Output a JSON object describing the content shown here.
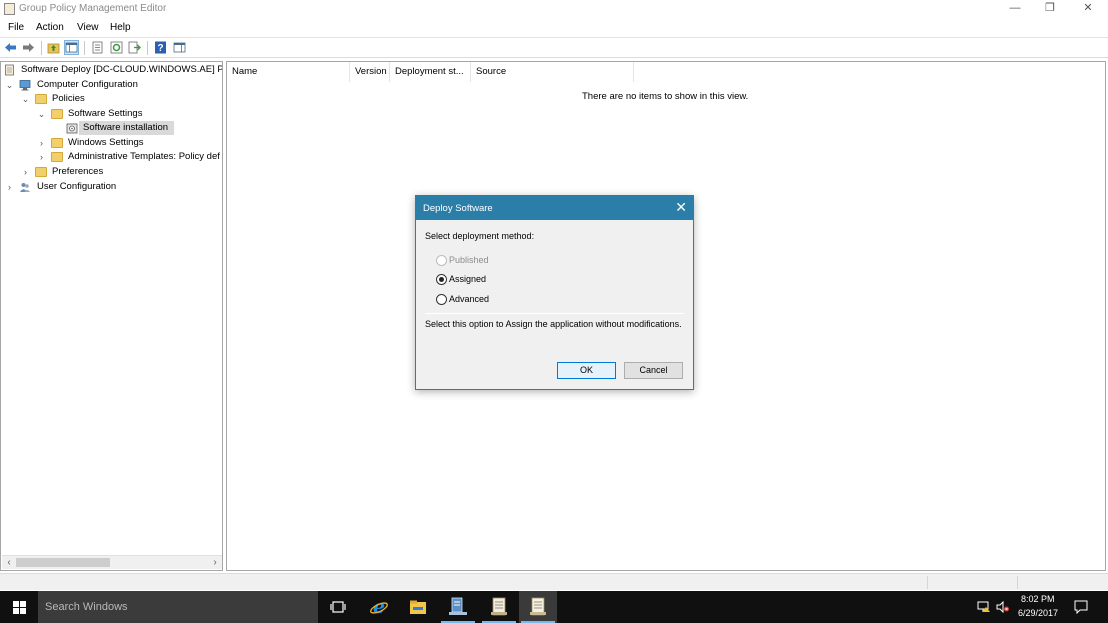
{
  "window": {
    "title": "Group Policy Management Editor",
    "minimize_glyph": "—",
    "restore_glyph": "❐",
    "close_glyph": "✕"
  },
  "menu": [
    "File",
    "Action",
    "View",
    "Help"
  ],
  "toolbar": {
    "icons": [
      "back-arrow-icon",
      "forward-arrow-icon",
      "up-folder-icon",
      "show-hide-console-tree-icon",
      "properties-icon",
      "refresh-icon",
      "export-list-icon",
      "help-icon",
      "show-action-pane-icon"
    ]
  },
  "tree": {
    "root": "Software Deploy [DC-CLOUD.WINDOWS.AE] Po",
    "computer_configuration": "Computer Configuration",
    "policies": "Policies",
    "software_settings": "Software Settings",
    "software_installation": "Software installation",
    "windows_settings": "Windows Settings",
    "administrative_templates": "Administrative Templates: Policy def",
    "preferences": "Preferences",
    "user_configuration": "User Configuration"
  },
  "list": {
    "columns": [
      "Name",
      "Version",
      "Deployment st...",
      "Source"
    ],
    "empty_message": "There are no items to show in this view."
  },
  "dialog": {
    "title": "Deploy Software",
    "prompt": "Select deployment method:",
    "options": [
      {
        "label": "Published",
        "selected": false,
        "enabled": false
      },
      {
        "label": "Assigned",
        "selected": true,
        "enabled": true
      },
      {
        "label": "Advanced",
        "selected": false,
        "enabled": true
      }
    ],
    "description": "Select this option to Assign the application without modifications.",
    "ok_label": "OK",
    "cancel_label": "Cancel"
  },
  "taskbar": {
    "search_placeholder": "Search Windows",
    "time": "8:02 PM",
    "date": "6/29/2017"
  },
  "colors": {
    "dialog_title": "#2b7ea8",
    "taskbar": "#101010",
    "selection": "#d9d9d9",
    "folder": "#f2cf6b"
  }
}
